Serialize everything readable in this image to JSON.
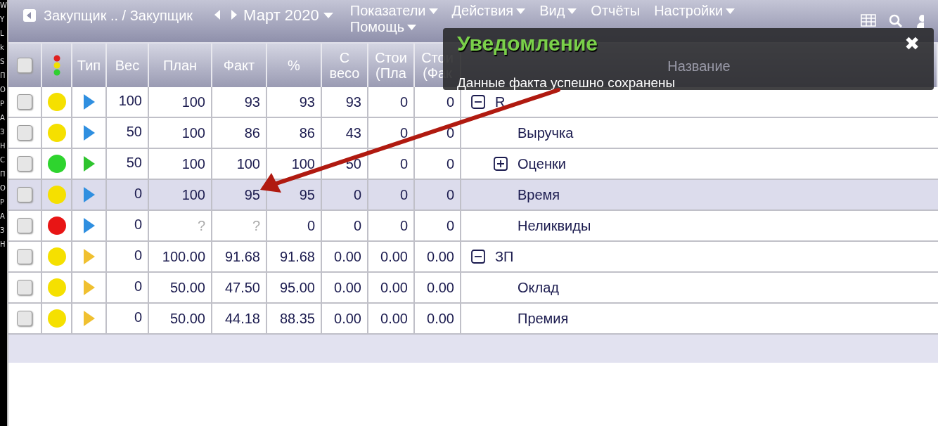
{
  "left_strip": [
    "W",
    "Y",
    "L",
    "k",
    "S",
    "П",
    "О",
    "Р",
    "А",
    "З",
    "Н",
    "С",
    "П",
    "О",
    "Р",
    "А",
    "З",
    "Н"
  ],
  "toolbar": {
    "breadcrumb": "Закупщик .. / Закупщик",
    "period": "Март 2020",
    "menus": [
      {
        "label": "Показатели",
        "dropdown": true
      },
      {
        "label": "Действия",
        "dropdown": true
      },
      {
        "label": "Вид",
        "dropdown": true
      },
      {
        "label": "Отчёты",
        "dropdown": false
      },
      {
        "label": "Настройки",
        "dropdown": true
      },
      {
        "label": "Помощь",
        "dropdown": true
      }
    ]
  },
  "table": {
    "header_checked": false,
    "columns": [
      "Тип",
      "Вес",
      "План",
      "Факт",
      "%",
      "С весо",
      "Стои (Пла",
      "Стои (Фак",
      "Название"
    ],
    "rows": [
      {
        "checked": false,
        "selected": false,
        "color": "#f5e000",
        "cells": [
          {
            "kind": "plain"
          },
          {
            "v": "100",
            "muted": false
          },
          {
            "v": "100",
            "muted": false
          },
          {
            "v": "93",
            "muted": false
          },
          {
            "v": "93",
            "muted": false
          },
          {
            "v": "93",
            "muted": false
          },
          {
            "v": "0",
            "muted": false
          },
          {
            "v": "0",
            "muted": false
          }
        ],
        "name": "R",
        "expanded": true,
        "children": [
          {
            "checked": false,
            "selected": false,
            "color": "#f5e000",
            "cells": [
              {
                "kind": "plain"
              },
              {
                "v": "50",
                "muted": false
              },
              {
                "v": "100",
                "muted": false
              },
              {
                "v": "86",
                "muted": false
              },
              {
                "v": "86",
                "muted": false
              },
              {
                "v": "43",
                "muted": false
              },
              {
                "v": "0",
                "muted": false
              },
              {
                "v": "0",
                "muted": false
              }
            ],
            "name": "Выручка"
          },
          {
            "checked": false,
            "selected": false,
            "color": "#2ed42e",
            "cells": [
              {
                "kind": "done"
              },
              {
                "v": "50",
                "muted": false
              },
              {
                "v": "100",
                "muted": false
              },
              {
                "v": "100",
                "muted": false
              },
              {
                "v": "100",
                "muted": false
              },
              {
                "v": "50",
                "muted": false
              },
              {
                "v": "0",
                "muted": false
              },
              {
                "v": "0",
                "muted": false
              }
            ],
            "name": "Оценки",
            "expanded": false
          },
          {
            "checked": false,
            "selected": true,
            "color": "#f5e000",
            "cells": [
              {
                "kind": "plain"
              },
              {
                "v": "0",
                "muted": false
              },
              {
                "v": "100",
                "muted": false
              },
              {
                "v": "95",
                "muted": false
              },
              {
                "v": "95",
                "muted": false
              },
              {
                "v": "0",
                "muted": false
              },
              {
                "v": "0",
                "muted": false
              },
              {
                "v": "0",
                "muted": false
              }
            ],
            "name": "Время"
          },
          {
            "checked": false,
            "selected": false,
            "color": "#e81515",
            "cells": [
              {
                "kind": "plain"
              },
              {
                "v": "0",
                "muted": false
              },
              {
                "v": "?",
                "muted": true
              },
              {
                "v": "?",
                "muted": true
              },
              {
                "v": "0",
                "muted": false
              },
              {
                "v": "0",
                "muted": false
              },
              {
                "v": "0",
                "muted": false
              },
              {
                "v": "0",
                "muted": false
              }
            ],
            "name": "Неликвиды"
          }
        ]
      },
      {
        "checked": false,
        "selected": false,
        "color": "#f5e000",
        "cells": [
          {
            "kind": "derived"
          },
          {
            "v": "0",
            "muted": false
          },
          {
            "v": "100.00",
            "muted": false
          },
          {
            "v": "91.68",
            "muted": false
          },
          {
            "v": "91.68",
            "muted": false
          },
          {
            "v": "0.00",
            "muted": false
          },
          {
            "v": "0.00",
            "muted": false
          },
          {
            "v": "0.00",
            "muted": false
          }
        ],
        "name": "ЗП",
        "expanded": true,
        "children": [
          {
            "checked": false,
            "selected": false,
            "color": "#f5e000",
            "cells": [
              {
                "kind": "derived"
              },
              {
                "v": "0",
                "muted": false
              },
              {
                "v": "50.00",
                "muted": false
              },
              {
                "v": "47.50",
                "muted": false
              },
              {
                "v": "95.00",
                "muted": false
              },
              {
                "v": "0.00",
                "muted": false
              },
              {
                "v": "0.00",
                "muted": false
              },
              {
                "v": "0.00",
                "muted": false
              }
            ],
            "name": "Оклад"
          },
          {
            "checked": false,
            "selected": false,
            "color": "#f5e000",
            "cells": [
              {
                "kind": "derived"
              },
              {
                "v": "0",
                "muted": false
              },
              {
                "v": "50.00",
                "muted": false
              },
              {
                "v": "44.18",
                "muted": false
              },
              {
                "v": "88.35",
                "muted": false
              },
              {
                "v": "0.00",
                "muted": false
              },
              {
                "v": "0.00",
                "muted": false
              },
              {
                "v": "0.00",
                "muted": false
              }
            ],
            "name": "Премия"
          }
        ]
      }
    ]
  },
  "notification": {
    "title": "Уведомление",
    "message": "Данные факта успешно сохранены",
    "close": "✖"
  }
}
